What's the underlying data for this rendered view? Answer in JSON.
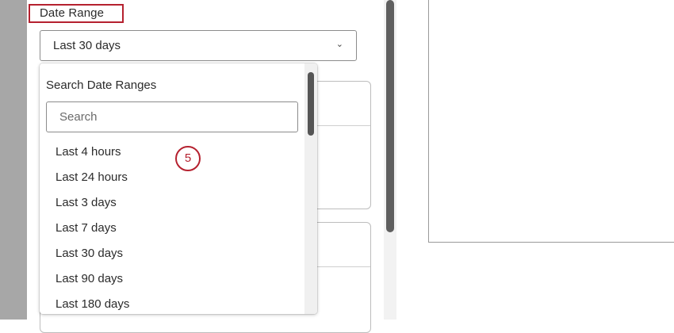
{
  "filter": {
    "label": "Date Range",
    "selected_value": "Last 30 days",
    "chevron_icon": "chevron-down-icon"
  },
  "dropdown": {
    "heading": "Search Date Ranges",
    "search_placeholder": "Search",
    "options": [
      {
        "label": "Last 4 hours"
      },
      {
        "label": "Last 24 hours"
      },
      {
        "label": "Last 3 days"
      },
      {
        "label": "Last 7 days"
      },
      {
        "label": "Last 30 days"
      },
      {
        "label": "Last 90 days"
      },
      {
        "label": "Last 180 days"
      }
    ]
  },
  "annotation": {
    "step_number": "5",
    "highlight_color": "#b5212f"
  }
}
